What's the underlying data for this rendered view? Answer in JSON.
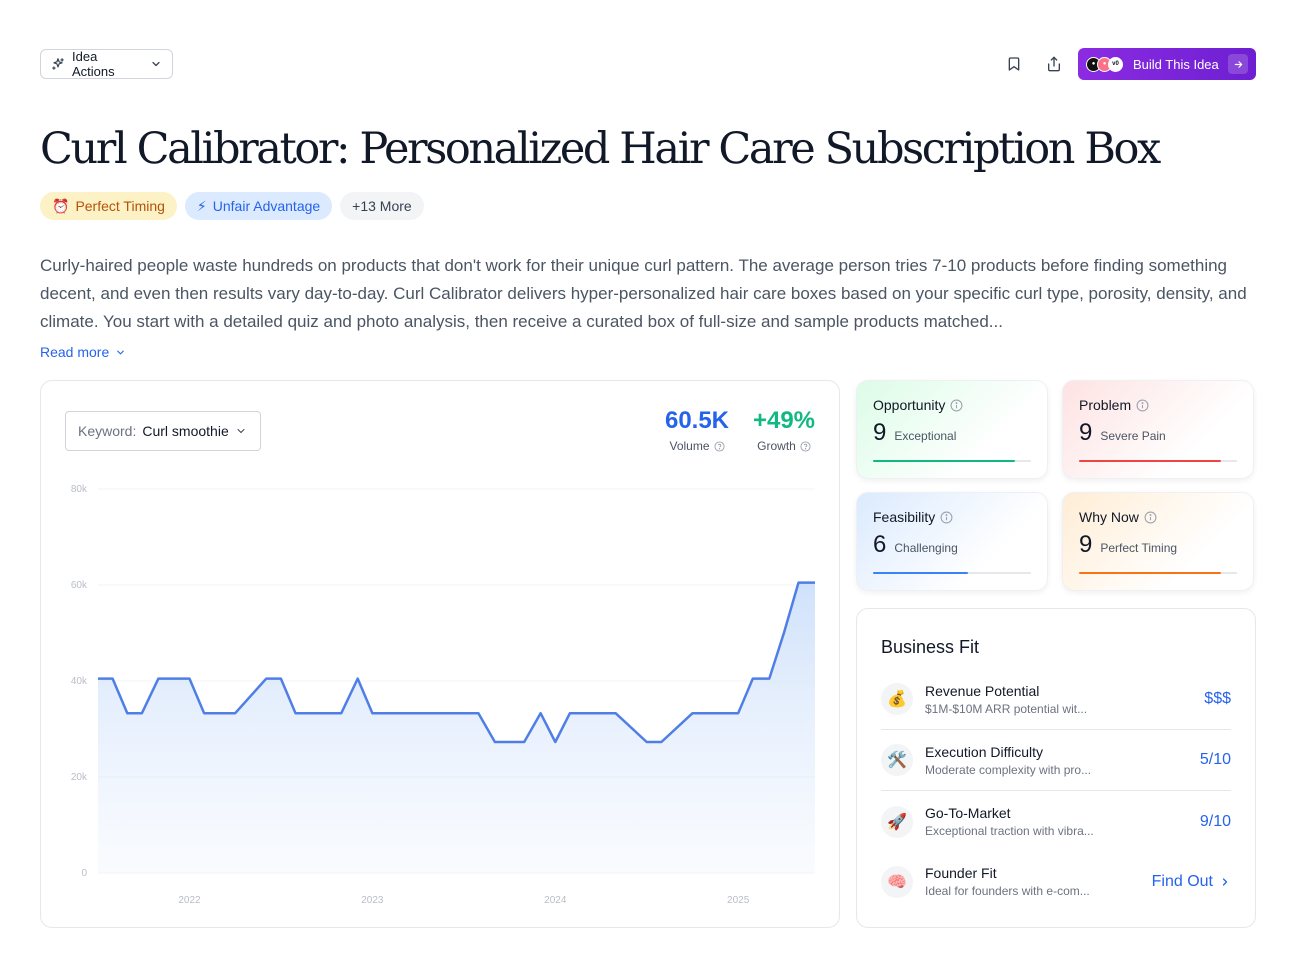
{
  "toolbar": {
    "idea_actions_label": "Idea Actions",
    "build_label": "Build This Idea"
  },
  "title": "Curl Calibrator: Personalized Hair Care Subscription Box",
  "tags": [
    {
      "emoji": "⏰",
      "label": "Perfect Timing"
    },
    {
      "emoji": "⚡",
      "label": "Unfair Advantage"
    },
    {
      "label": "+13 More"
    }
  ],
  "description": "Curly-haired people waste hundreds on products that don't work for their unique curl pattern. The average person tries 7-10 products before finding something decent, and even then results vary day-to-day. Curl Calibrator delivers hyper-personalized hair care boxes based on your specific curl type, porosity, density, and climate. You start with a detailed quiz and photo analysis, then receive a curated box of full-size and sample products matched...",
  "read_more_label": "Read more",
  "keyword": {
    "label": "Keyword:",
    "value": "Curl smoothie"
  },
  "stats": {
    "volume": {
      "value": "60.5K",
      "label": "Volume",
      "color": "#2563eb"
    },
    "growth": {
      "value": "+49%",
      "label": "Growth",
      "color": "#10b981"
    }
  },
  "chart_data": {
    "type": "area",
    "x_ticks": [
      "2022",
      "2023",
      "2024",
      "2025"
    ],
    "y_ticks": [
      "0",
      "20k",
      "40k",
      "60k",
      "80k"
    ],
    "ylim": [
      0,
      80000
    ],
    "xlim": [
      2021.5,
      2025.42
    ],
    "line_color": "#4f7fe6",
    "x": [
      2021.5,
      2021.58,
      2021.66,
      2021.74,
      2021.83,
      2022.0,
      2022.08,
      2022.25,
      2022.42,
      2022.5,
      2022.58,
      2022.75,
      2022.83,
      2022.92,
      2023.0,
      2023.08,
      2023.25,
      2023.42,
      2023.58,
      2023.67,
      2023.83,
      2023.92,
      2024.0,
      2024.08,
      2024.17,
      2024.25,
      2024.33,
      2024.5,
      2024.58,
      2024.75,
      2024.83,
      2025.0,
      2025.08,
      2025.17,
      2025.25,
      2025.33,
      2025.42
    ],
    "values": [
      40500,
      40500,
      33300,
      33300,
      40500,
      40500,
      33300,
      33300,
      40500,
      40500,
      33300,
      33300,
      33300,
      40500,
      33300,
      33300,
      33300,
      33300,
      33300,
      27300,
      27300,
      33300,
      27300,
      33300,
      33300,
      33300,
      33300,
      27300,
      27300,
      33300,
      33300,
      33300,
      40500,
      40500,
      50000,
      60500,
      60500
    ]
  },
  "metrics": [
    {
      "title": "Opportunity",
      "score": "9",
      "desc": "Exceptional",
      "fill": 0.9,
      "color": "#10b981"
    },
    {
      "title": "Problem",
      "score": "9",
      "desc": "Severe Pain",
      "fill": 0.9,
      "color": "#ef4444"
    },
    {
      "title": "Feasibility",
      "score": "6",
      "desc": "Challenging",
      "fill": 0.6,
      "color": "#3b82f6"
    },
    {
      "title": "Why Now",
      "score": "9",
      "desc": "Perfect Timing",
      "fill": 0.9,
      "color": "#f97316"
    }
  ],
  "business_fit": {
    "title": "Business Fit",
    "rows": [
      {
        "icon": "💰",
        "name": "Revenue Potential",
        "sub": "$1M-$10M ARR potential wit...",
        "value": "$$$"
      },
      {
        "icon": "🛠️",
        "name": "Execution Difficulty",
        "sub": "Moderate complexity with pro...",
        "value": "5/10"
      },
      {
        "icon": "🚀",
        "name": "Go-To-Market",
        "sub": "Exceptional traction with vibra...",
        "value": "9/10"
      },
      {
        "icon": "🧠",
        "name": "Founder Fit",
        "sub": "Ideal for founders with e-com...",
        "value": "Find Out"
      }
    ]
  }
}
